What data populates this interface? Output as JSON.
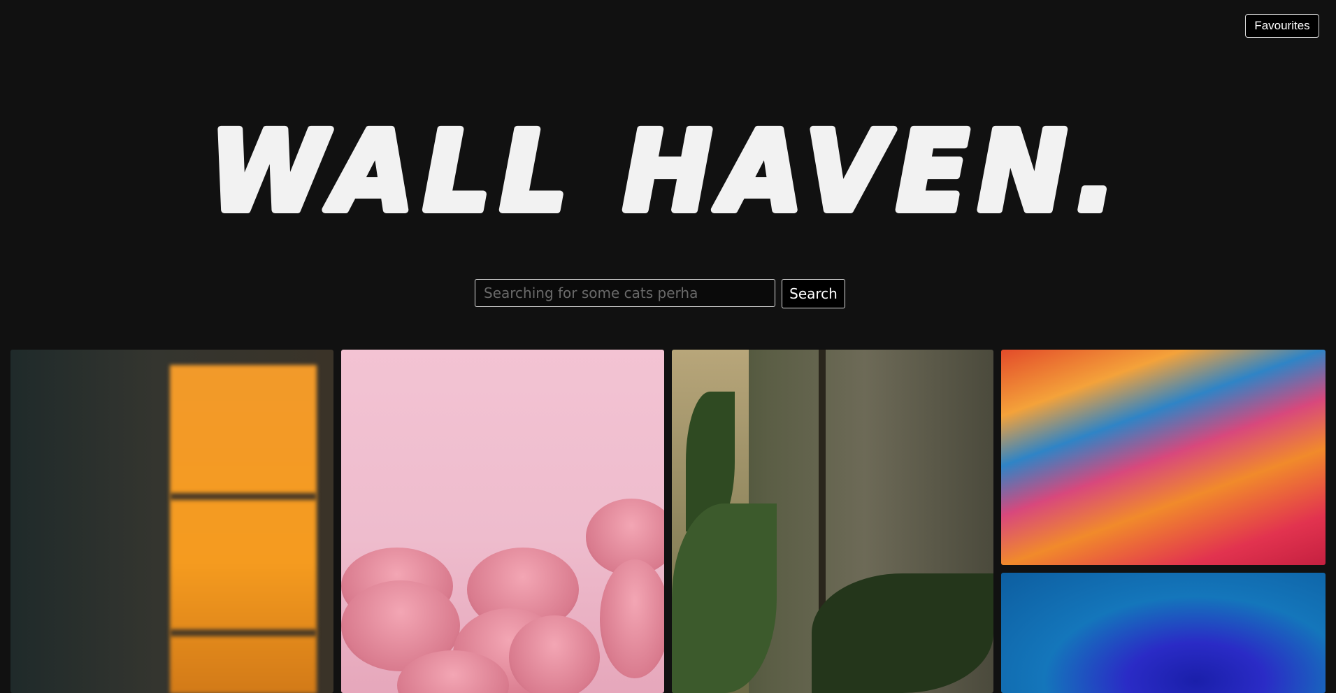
{
  "header": {
    "favourites_label": "Favourites"
  },
  "logo": {
    "text": "WALL HAVEN."
  },
  "search": {
    "placeholder": "Searching for some cats perha",
    "button_label": "Search"
  },
  "gallery": {
    "images": [
      {
        "subject": "sunlight-window-shadow-on-wall"
      },
      {
        "subject": "pink-macarons"
      },
      {
        "subject": "plants-by-window"
      },
      {
        "subject": "colorful-paint-swirl"
      },
      {
        "subject": "blue-rose"
      }
    ]
  }
}
